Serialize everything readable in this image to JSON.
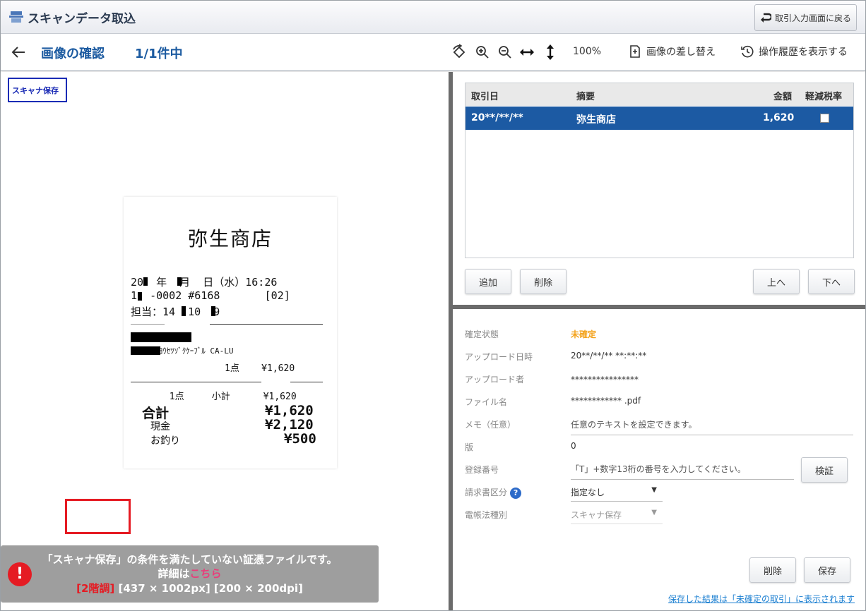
{
  "title_bar": {
    "app_title": "スキャンデータ取込",
    "back_button_label": "取引入力画面に戻る"
  },
  "toolbar": {
    "page_title": "画像の確認",
    "page_count": "1/1件中",
    "zoom_level": "100%",
    "replace_image_label": "画像の差し替え",
    "history_label": "操作履歴を表示する"
  },
  "left_pane": {
    "scanner_badge": "スキャナ保存",
    "receipt": {
      "shop_name": "弥生商店",
      "date_line": "20  年  月  日（水）16:26",
      "id_line": "1  -0002 #6168       [02]",
      "staff_line": "担当：14  10  9",
      "item_line": "      ﾖｳｾﾂｿﾞｸｹｰﾌﾞﾙ CA-LU",
      "qty_line": "                 1点    ¥1,620",
      "subtotal_line": "       1点     小計      ¥1,620",
      "total_label": "合計",
      "total_value": "¥1,620",
      "cash_label": "現金",
      "cash_value": "¥2,120",
      "change_label": "お釣り",
      "change_value": "¥500"
    },
    "warning": {
      "line1": "「スキャナ保存」の条件を満たしていない証憑ファイルです。",
      "line2_prefix": "詳細は",
      "line2_link": "こちら",
      "line3_red": "[2階調]",
      "line3_rest": " [437 × 1002px] [200 × 200dpi]"
    }
  },
  "transactions": {
    "columns": [
      "取引日",
      "摘要",
      "金額",
      "軽減税率"
    ],
    "rows": [
      {
        "date": "20**/**/**",
        "summary": "弥生商店",
        "amount": "1,620",
        "reduced_tax": false
      }
    ],
    "buttons": {
      "add": "追加",
      "delete": "削除",
      "up": "上へ",
      "down": "下へ"
    }
  },
  "details": {
    "status_label": "確定状態",
    "status_value": "未確定",
    "upload_date_label": "アップロード日時",
    "upload_date_value": "20**/**/** **:**:**",
    "uploader_label": "アップロード者",
    "uploader_value": "****************",
    "filename_label": "ファイル名",
    "filename_value": "************ .pdf",
    "memo_label": "メモ（任意）",
    "memo_placeholder": "任意のテキストを設定できます。",
    "version_label": "版",
    "version_value": "0",
    "reg_number_label": "登録番号",
    "reg_number_placeholder": "「T」+数字13桁の番号を入力してください。",
    "verify_button": "検証",
    "invoice_type_label": "請求書区分",
    "invoice_type_value": "指定なし",
    "ebook_type_label": "電帳法種別",
    "ebook_type_value": "スキャナ保存",
    "delete_button": "削除",
    "save_button": "保存",
    "footnote": "保存した結果は「未確定の取引」に表示されます"
  },
  "colors": {
    "accent": "#1c5aa3",
    "warning_red": "#e51b23",
    "status_orange": "#f3a21b",
    "link_blue": "#1b7fd1"
  }
}
